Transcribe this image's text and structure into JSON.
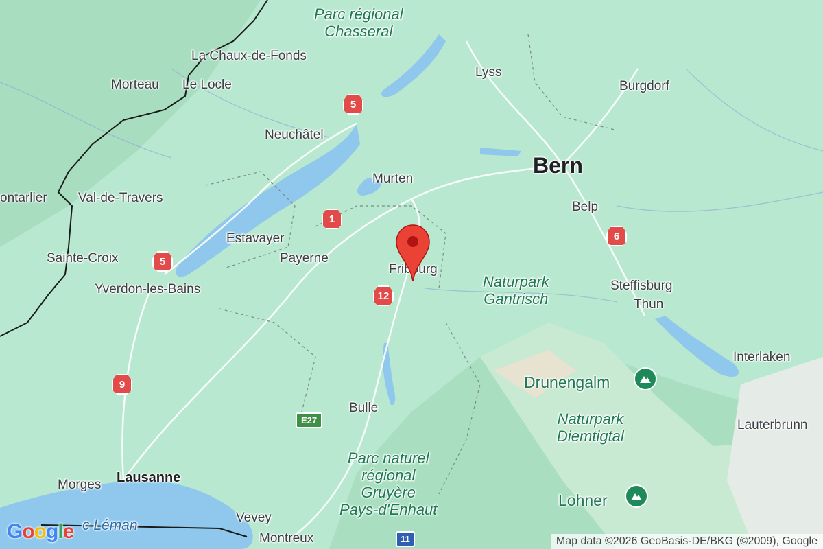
{
  "labels": {
    "parc_chasseral": "Parc régional\nChasseral",
    "la_chaux_de_fonds": "La Chaux-de-Fonds",
    "morteau": "Morteau",
    "le_locle": "Le Locle",
    "lyss": "Lyss",
    "burgdorf": "Burgdorf",
    "neuchatel": "Neuchâtel",
    "bern": "Bern",
    "murten": "Murten",
    "pontarlier": "ontarlier",
    "val_de_travers": "Val-de-Travers",
    "belp": "Belp",
    "estavayer": "Estavayer",
    "payerne": "Payerne",
    "sainte_croix": "Sainte-Croix",
    "fribourg": "Fribourg",
    "naturpark_gantrisch": "Naturpark\nGantrisch",
    "steffisburg": "Steffisburg",
    "thun": "Thun",
    "yverdon": "Yverdon-les-Bains",
    "interlaken": "Interlaken",
    "drunengalm": "Drunengalm",
    "bulle": "Bulle",
    "naturpark_diemtigtal": "Naturpark\nDiemtigtal",
    "lauterbrunn": "Lauterbrunn",
    "parc_gruyere": "Parc naturel\nrégional\nGruyère\nPays-d'Enhaut",
    "lausanne": "Lausanne",
    "morges": "Morges",
    "lohner": "Lohner",
    "vevey": "Vevey",
    "montreux": "Montreux",
    "lac_leman": "c Léman"
  },
  "routes": {
    "r5_north": "5",
    "r1": "1",
    "r5_west": "5",
    "r12": "12",
    "r6": "6",
    "r9": "9",
    "e27": "E27",
    "r11": "11"
  },
  "icons": {
    "marker": "location-pin-icon",
    "peak": "mountain-icon"
  },
  "colors": {
    "land": "#b8e8cf",
    "water": "#8fc8ec",
    "marker": "#ea4335",
    "route": "#e24b4a"
  },
  "attribution": "Map data ©2026 GeoBasis-DE/BKG (©2009), Google",
  "logo": {
    "letters": [
      "G",
      "o",
      "o",
      "g",
      "l",
      "e"
    ],
    "colors": [
      "#4285f4",
      "#ea4335",
      "#fbbc05",
      "#4285f4",
      "#34a853",
      "#ea4335"
    ]
  }
}
